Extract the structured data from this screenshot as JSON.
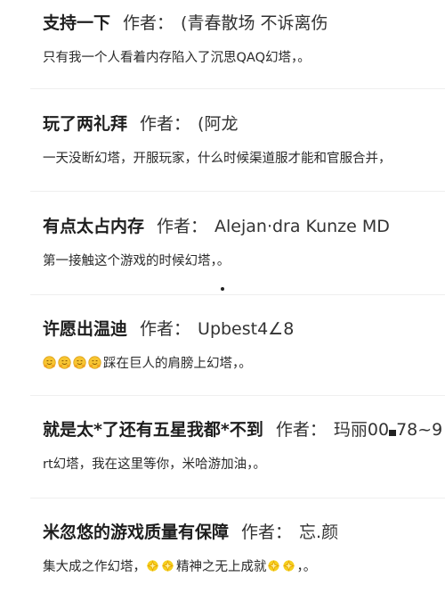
{
  "reviews": [
    {
      "title": "支持一下",
      "author_label": "作者：",
      "author": "(青春散场 不诉离伤",
      "body": "只有我一个人看着内存陷入了沉思QAQ幻塔，。"
    },
    {
      "title": "玩了两礼拜",
      "author_label": "作者：",
      "author": "(阿龙",
      "body": "一天没断幻塔，开服玩家，什么时候渠道服才能和官服合并，"
    },
    {
      "title": "有点太占内存",
      "author_label": "作者：",
      "author": "Alejan·dra Kunze MD",
      "body": "第一接触这个游戏的时候幻塔，。"
    },
    {
      "title": "许愿出温迪",
      "author_label": "作者：",
      "author": "Upbest4∠8",
      "body_emoji": [
        "hugging-face-icon",
        "hugging-face-icon",
        "hugging-face-icon",
        "hugging-face-icon"
      ],
      "body": "踩在巨人的肩膀上幻塔，。"
    },
    {
      "title": "就是太*了还有五星我都*不到",
      "author_label": "作者：",
      "author_part1": "玛丽00",
      "author_part2": "78~9",
      "body": "rt幻塔，我在这里等你，米哈游加油，。"
    },
    {
      "title": "米忽悠的游戏质量有保障",
      "author_label": "作者：",
      "author": "忘.颜",
      "body_part1": "集大成之作幻塔，",
      "body_part2": "精神之无上成就",
      "body_part3": "，。",
      "body_emoji": [
        "sparkle-star-icon",
        "sparkle-star-icon",
        "sparkle-star-icon",
        "sparkle-star-icon"
      ]
    }
  ]
}
